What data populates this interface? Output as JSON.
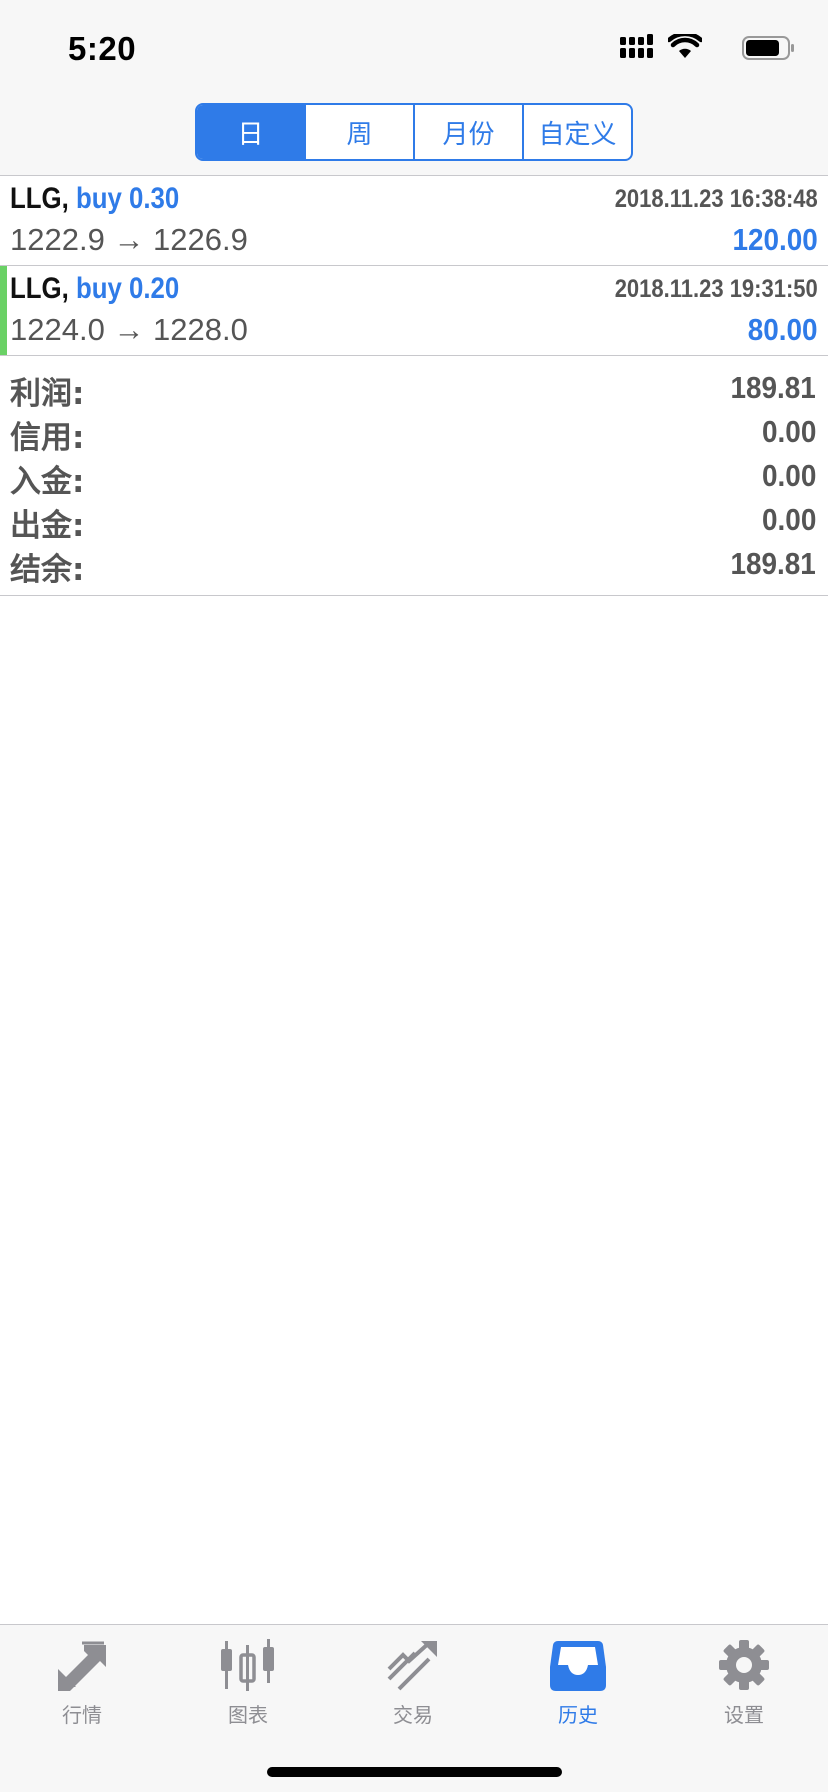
{
  "status_bar": {
    "time": "5:20"
  },
  "period_tabs": [
    {
      "label": "日",
      "active": true
    },
    {
      "label": "周",
      "active": false
    },
    {
      "label": "月份",
      "active": false
    },
    {
      "label": "自定义",
      "active": false
    }
  ],
  "trades": [
    {
      "symbol": "LLG,",
      "side": "buy 0.30",
      "time": "2018.11.23 16:38:48",
      "prices": "1222.9 → 1226.9",
      "profit": "120.00",
      "highlighted": false
    },
    {
      "symbol": "LLG,",
      "side": "buy 0.20",
      "time": "2018.11.23 19:31:50",
      "prices": "1224.0 → 1228.0",
      "profit": "80.00",
      "highlighted": true
    }
  ],
  "summary": [
    {
      "label": "利润:",
      "value": "189.81"
    },
    {
      "label": "信用:",
      "value": "0.00"
    },
    {
      "label": "入金:",
      "value": "0.00"
    },
    {
      "label": "出金:",
      "value": "0.00"
    },
    {
      "label": "结余:",
      "value": "189.81"
    }
  ],
  "tab_bar": [
    {
      "label": "行情",
      "icon": "quotes-icon",
      "active": false
    },
    {
      "label": "图表",
      "icon": "chart-icon",
      "active": false
    },
    {
      "label": "交易",
      "icon": "trade-icon",
      "active": false
    },
    {
      "label": "历史",
      "icon": "history-icon",
      "active": true
    },
    {
      "label": "设置",
      "icon": "gear-icon",
      "active": false
    }
  ],
  "colors": {
    "accent": "#2f7be8",
    "highlight_bar": "#6ad165",
    "inactive": "#8e8e93"
  }
}
